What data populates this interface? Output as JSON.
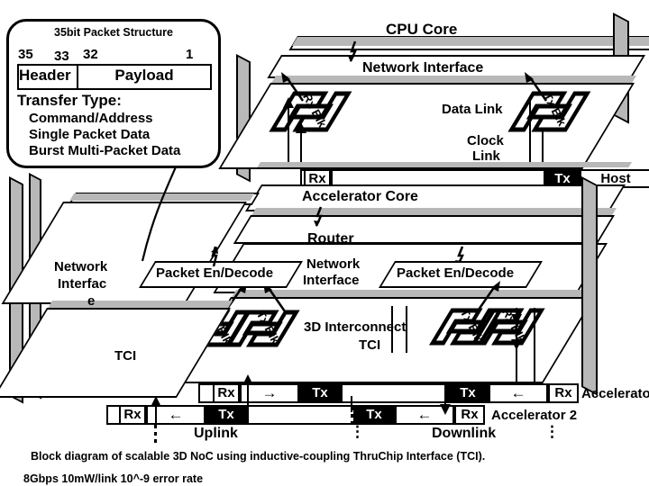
{
  "packet_box": {
    "title": "35bit Packet Structure",
    "bits": {
      "msb": "35",
      "hdr_end": "33",
      "payload_start": "32",
      "lsb": "1"
    },
    "fields": {
      "header": "Header",
      "payload": "Payload"
    },
    "transfer_type_label": "Transfer Type:",
    "transfer_types": [
      "Command/Address",
      "Single Packet Data",
      "Burst Multi-Packet Data"
    ]
  },
  "layers": {
    "cpu": {
      "core_label": "CPU Core",
      "network_interface": "Network Interface",
      "rx_blk": "Rx Blk",
      "tx_blk": "Tx Blk",
      "data_link": "Data Link",
      "clock_link_1": "Clock",
      "clock_link_2": "Link",
      "bar_rx": "Rx",
      "bar_tx": "Tx",
      "bar_host": "Host"
    },
    "accelerator": {
      "core_label": "Accelerator Core",
      "router": "Router",
      "network_interface_1": "Network",
      "network_interface_2": "Interface",
      "packet_codec_left": "Packet En/Decode",
      "packet_codec_right": "Packet En/Decode",
      "interconnect_1": "3D Interconnect",
      "interconnect_2": "TCI",
      "rx_blk_left": "Rx Blk",
      "tx_blk_left": "Tx Blk",
      "tx_blk_right": "Tx Blk",
      "rx_blk_right": "Rx Blk"
    },
    "left_stack": {
      "network_interface_1": "Network",
      "network_interface_2": "Interfac",
      "network_interface_3": "e",
      "tci": "TCI"
    }
  },
  "link_bars": {
    "upper": {
      "rx": "Rx",
      "arrow": "→",
      "tx": "Tx",
      "tx_right": "Tx",
      "arrow_right": "←",
      "rx_right": "Rx",
      "accelerator": "Accelerator"
    },
    "lower": {
      "rx": "Rx",
      "arrow": "←",
      "tx": "Tx",
      "tx_right": "Tx",
      "arrow_right": "←",
      "rx_right": "Rx",
      "accelerator": "Accelerator 2"
    },
    "uplink": "Uplink",
    "downlink": "Downlink",
    "ellipsis": "⋮"
  },
  "caption": {
    "line1": "Block diagram of scalable 3D NoC using inductive-coupling ThruChip Interface (TCI).",
    "line2": "8Gbps  10mW/link 10^-9 error rate"
  },
  "colors": {
    "ink": "#000000",
    "shade": "#b8b8b8",
    "paper": "#ffffff"
  }
}
